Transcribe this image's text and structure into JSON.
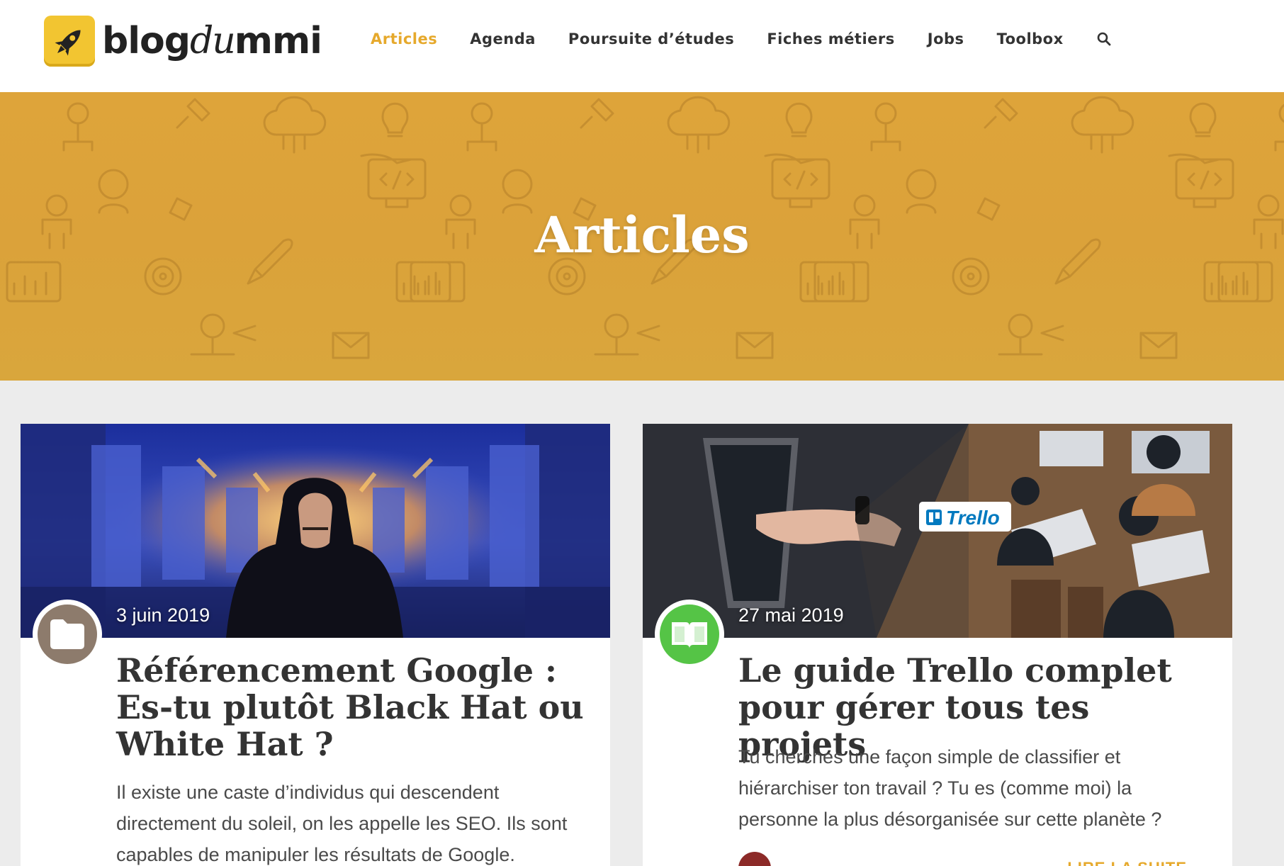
{
  "logo": {
    "text_bold": "blog",
    "text_italic": "du",
    "text_end": "mmi"
  },
  "nav": {
    "items": [
      {
        "label": "Articles",
        "active": true
      },
      {
        "label": "Agenda"
      },
      {
        "label": "Poursuite d’études"
      },
      {
        "label": "Fiches métiers"
      },
      {
        "label": "Jobs"
      },
      {
        "label": "Toolbox"
      }
    ],
    "search_icon": "search-icon"
  },
  "hero": {
    "title": "Articles"
  },
  "colors": {
    "accent": "#e6a92c",
    "hero": "#dca33a",
    "badge_folder": "#8d7b6c",
    "badge_book": "#55c446"
  },
  "articles": [
    {
      "date": "3 juin 2019",
      "badge_icon": "folder-icon",
      "title": "Référencement Google : Es-tu plutôt Black Hat ou White Hat ?",
      "excerpt": "Il existe une caste d’individus qui descendent directement du soleil, on les appelle les SEO. Ils sont capables de manipuler les résultats de Google."
    },
    {
      "date": "27 mai 2019",
      "badge_icon": "book-icon",
      "title": "Le guide Trello complet pour gérer tous tes projets",
      "excerpt": "Tu cherches une façon simple de classifier et hiérarchiser ton travail ? Tu es (comme moi) la personne la plus désorganisée sur cette planète ?",
      "image_label": "Trello",
      "read_more": "LIRE LA SUITE"
    }
  ]
}
